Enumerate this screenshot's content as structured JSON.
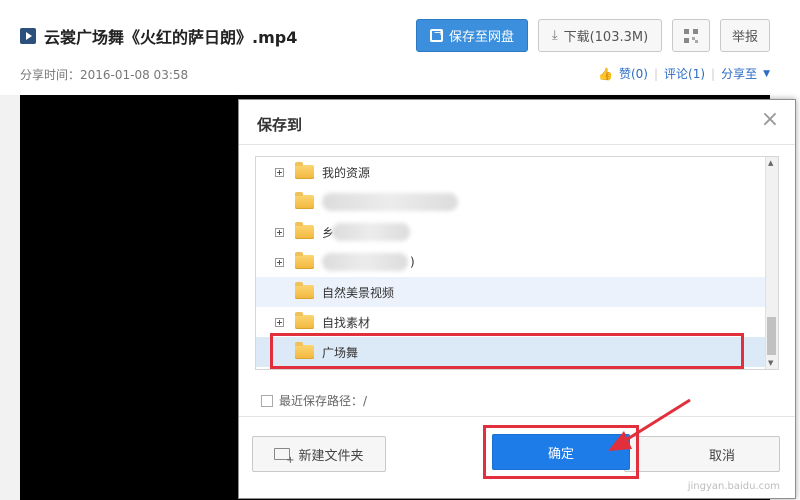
{
  "header": {
    "title": "云裳广场舞《火红的萨日朗》.mp4",
    "save_to_cloud_label": "保存至网盘",
    "download_label": "下载(103.3M)",
    "report_label": "举报",
    "share_time": "分享时间：2016-01-08 03:58",
    "like_label": "赞(0)",
    "comment_label": "评论(1)",
    "share_label": "分享至",
    "separator": "|"
  },
  "dialog": {
    "title": "保存到",
    "tree": [
      {
        "label": "我的资源",
        "expandable": true,
        "blurred": false
      },
      {
        "label": "",
        "expandable": false,
        "blurred": true
      },
      {
        "label": "乡",
        "expandable": true,
        "blurred": true
      },
      {
        "label": ")",
        "expandable": true,
        "blurred": true
      },
      {
        "label": "自然美景视频",
        "expandable": false,
        "blurred": false
      },
      {
        "label": "自找素材",
        "expandable": true,
        "blurred": false
      },
      {
        "label": "广场舞",
        "expandable": false,
        "blurred": false,
        "selected": true
      }
    ],
    "recent_path_label": "最近保存路径：/",
    "new_folder_label": "新建文件夹",
    "confirm_label": "确定",
    "cancel_label": "取消"
  },
  "watermark": "jingyan.baidu.com",
  "colors": {
    "primary_blue": "#1e7ce8",
    "highlight_red": "#e22f3c",
    "link_blue": "#2b6cc4"
  }
}
